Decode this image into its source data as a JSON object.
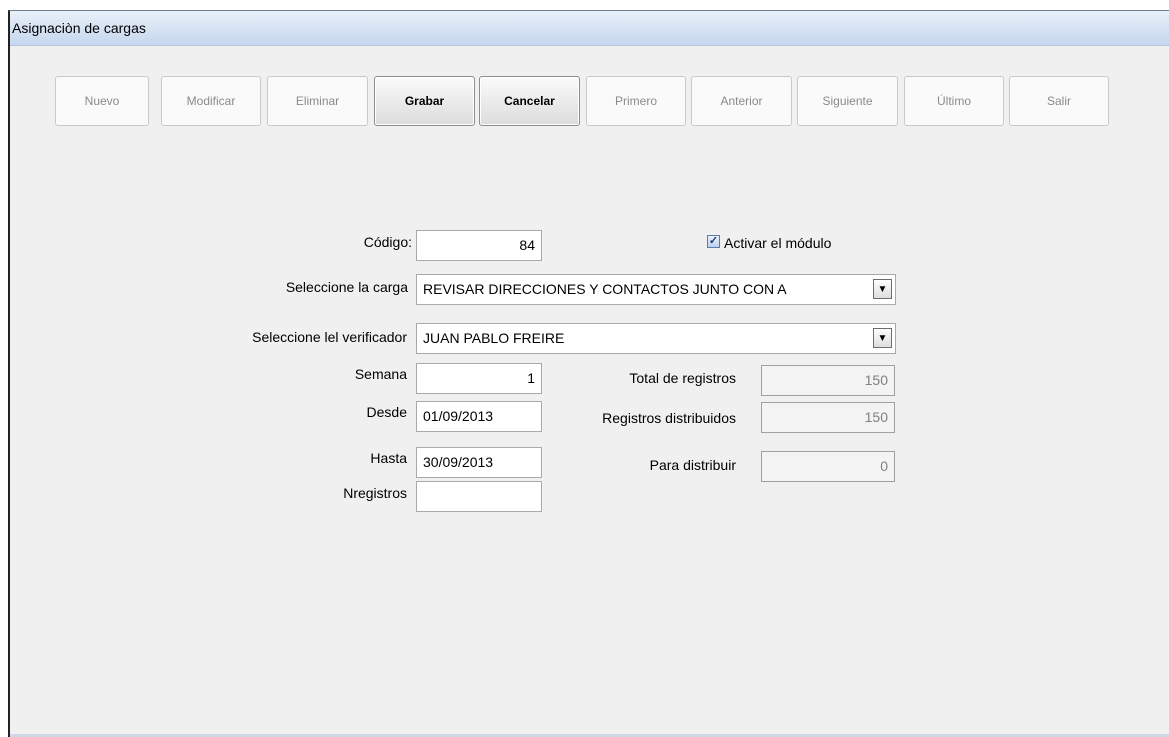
{
  "window": {
    "title": "Asignaciòn de cargas"
  },
  "toolbar": {
    "buttons": [
      {
        "label": "Nuevo",
        "enabled": false
      },
      {
        "label": "Modificar",
        "enabled": false
      },
      {
        "label": "Eliminar",
        "enabled": false
      },
      {
        "label": "Grabar",
        "enabled": true
      },
      {
        "label": "Cancelar",
        "enabled": true
      },
      {
        "label": "Primero",
        "enabled": false
      },
      {
        "label": "Anterior",
        "enabled": false
      },
      {
        "label": "Siguiente",
        "enabled": false
      },
      {
        "label": "Último",
        "enabled": false
      },
      {
        "label": "Salir",
        "enabled": false
      }
    ]
  },
  "form": {
    "codigo": {
      "label": "Código:",
      "value": "84"
    },
    "activar": {
      "label": "Activar el módulo",
      "checked": true
    },
    "carga": {
      "label": "Seleccione la carga",
      "value": "REVISAR DIRECCIONES Y CONTACTOS JUNTO CON A"
    },
    "verificador": {
      "label": "Seleccione lel verificador",
      "value": "JUAN PABLO FREIRE"
    },
    "semana": {
      "label": "Semana",
      "value": "1"
    },
    "desde": {
      "label": "Desde",
      "value": "01/09/2013"
    },
    "hasta": {
      "label": "Hasta",
      "value": "30/09/2013"
    },
    "nregistros": {
      "label": "Nregistros",
      "value": ""
    },
    "total": {
      "label": "Total de registros",
      "value": "150"
    },
    "distribuidos": {
      "label": "Registros distribuidos",
      "value": "150"
    },
    "para_distribuir": {
      "label": "Para distribuir",
      "value": "0"
    }
  },
  "icons": {
    "dropdown": "chevron-down-icon",
    "check": "checkmark-icon"
  }
}
